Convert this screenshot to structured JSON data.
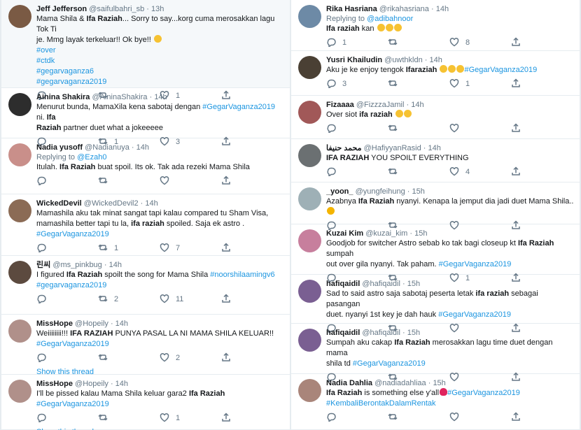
{
  "left": [
    {
      "name": "Jeff Jefferson",
      "handle": "@saifulbahri_sb",
      "time": "13h",
      "avatar_color": "#7a5a44",
      "lines": [
        [
          {
            "t": "Mama Shila & "
          },
          {
            "t": "Ifa Raziah",
            "b": true
          },
          {
            "t": "... Sorry to say...korg cuma merosakkan lagu Tok Ti"
          }
        ],
        [
          {
            "t": "je. Mmg layak terkeluar!! Ok bye!! "
          },
          {
            "e": "face"
          }
        ],
        [
          {
            "t": "#over",
            "tag": true
          }
        ],
        [
          {
            "t": "#ctdk",
            "tag": true
          }
        ],
        [
          {
            "t": "#gegarvaganza6",
            "tag": true
          }
        ],
        [
          {
            "t": "#gegarvaganza2019",
            "tag": true
          }
        ]
      ],
      "reply_count": "",
      "rt_count": "",
      "like_count": "1"
    },
    {
      "name": "Ainina Shakira",
      "handle": "@AininaShakira",
      "time": "14h",
      "avatar_color": "#2d2d2d",
      "lines": [
        [
          {
            "t": "Menurut bunda, MamaXila kena sabotaj dengan "
          },
          {
            "t": "#GegarVaganza2019",
            "tag": true
          },
          {
            "t": " ni. "
          },
          {
            "t": "Ifa",
            "b": true
          }
        ],
        [
          {
            "t": "Raziah",
            "b": true
          },
          {
            "t": " partner duet what a jokeeeee"
          }
        ]
      ],
      "reply_count": "",
      "rt_count": "1",
      "like_count": "3"
    },
    {
      "name": "Nadia yusoff",
      "handle": "@Nadianuya",
      "time": "14h",
      "avatar_color": "#c98f8a",
      "reply_to": "@Ezah0",
      "lines": [
        [
          {
            "t": "Itulah. "
          },
          {
            "t": "Ifa Raziah",
            "b": true
          },
          {
            "t": " buat spoil. Its ok. Tak ada rezeki Mama Shila"
          }
        ]
      ],
      "reply_count": "",
      "rt_count": "",
      "like_count": ""
    },
    {
      "name": "WickedDevil",
      "handle": "@WickedDevil2",
      "time": "14h",
      "avatar_color": "#8b6b55",
      "lines": [
        [
          {
            "t": "Mamashila aku tak minat sangat tapi kalau compared tu Sham Visa,"
          }
        ],
        [
          {
            "t": "mamashila better tapi tu la, "
          },
          {
            "t": "ifa raziah",
            "b": true
          },
          {
            "t": " spoiled. Saja ek astro ."
          }
        ],
        [
          {
            "t": "#GegarVaganza2019",
            "tag": true
          }
        ]
      ],
      "reply_count": "",
      "rt_count": "1",
      "like_count": "7"
    },
    {
      "name": "린씨",
      "handle": "@ms_pinkbug",
      "time": "14h",
      "avatar_color": "#5c4a3f",
      "lines": [
        [
          {
            "t": "I figured "
          },
          {
            "t": "Ifa Raziah",
            "b": true
          },
          {
            "t": " spoilt the song for Mama Shila "
          },
          {
            "t": "#noorshilaamingv6",
            "tag": true
          }
        ],
        [
          {
            "t": "#gegarvaganza2019",
            "tag": true
          }
        ]
      ],
      "reply_count": "",
      "rt_count": "2",
      "like_count": "11"
    },
    {
      "name": "MissHope",
      "handle": "@Hopeily",
      "time": "14h",
      "avatar_color": "#b0908a",
      "lines": [
        [
          {
            "t": "Weiiiiiiii!!! "
          },
          {
            "t": "IFA RAZIAH",
            "b": true
          },
          {
            "t": " PUNYA PASAL LA NI MAMA SHILA KELUAR!!"
          }
        ],
        [
          {
            "t": "#GegarVaganza2019",
            "tag": true
          }
        ]
      ],
      "reply_count": "",
      "rt_count": "",
      "like_count": "2",
      "show_thread": "Show this thread"
    },
    {
      "name": "MissHope",
      "handle": "@Hopeily",
      "time": "14h",
      "avatar_color": "#b0908a",
      "lines": [
        [
          {
            "t": "I'll be pissed kalau Mama Shila keluar gara2 "
          },
          {
            "t": "Ifa Raziah",
            "b": true
          },
          {
            "t": " "
          },
          {
            "t": "#GegarVaganza2019",
            "tag": true
          }
        ]
      ],
      "reply_count": "",
      "rt_count": "",
      "like_count": "1",
      "show_thread": "Show this thread"
    }
  ],
  "right": [
    {
      "name": "Rika Hasriana",
      "handle": "@rikahasriana",
      "time": "14h",
      "avatar_color": "#6d8aa6",
      "reply_to": "@adibahnoor",
      "lines": [
        [
          {
            "t": "Ifa raziah",
            "b": true
          },
          {
            "t": " kan "
          },
          {
            "e": "face"
          },
          {
            "e": "face"
          },
          {
            "e": "face"
          }
        ]
      ],
      "reply_count": "1",
      "rt_count": "",
      "like_count": "8"
    },
    {
      "name": "Yusri Khailudin",
      "handle": "@uwthkldn",
      "time": "14h",
      "avatar_color": "#4a4034",
      "lines": [
        [
          {
            "t": "Aku je ke enjoy tengok "
          },
          {
            "t": "Ifaraziah",
            "b": true
          },
          {
            "t": " "
          },
          {
            "e": "face"
          },
          {
            "e": "face"
          },
          {
            "e": "face"
          },
          {
            "t": "#GegarVaganza2019",
            "tag": true
          }
        ]
      ],
      "reply_count": "3",
      "rt_count": "",
      "like_count": "1"
    },
    {
      "name": "Fizaaaa",
      "handle": "@FizzzaJamil",
      "time": "14h",
      "avatar_color": "#a15858",
      "lines": [
        [
          {
            "t": "Over siot "
          },
          {
            "t": "ifa raziah",
            "b": true
          },
          {
            "t": " "
          },
          {
            "e": "face"
          },
          {
            "e": "face"
          }
        ]
      ],
      "reply_count": "",
      "rt_count": "",
      "like_count": ""
    },
    {
      "name": "محمد حنيفا",
      "handle": "@HafiyyanRasid",
      "time": "14h",
      "avatar_color": "#6b7072",
      "lines": [
        [
          {
            "t": "IFA RAZIAH",
            "b": true
          },
          {
            "t": " YOU SPOILT EVERYTHING"
          }
        ]
      ],
      "reply_count": "",
      "rt_count": "",
      "like_count": "4"
    },
    {
      "name": "_yoon_",
      "handle": "@yungfeihung",
      "time": "15h",
      "avatar_color": "#9eb0b6",
      "lines": [
        [
          {
            "t": "Azabnya "
          },
          {
            "t": "Ifa Raziah",
            "b": true
          },
          {
            "t": " nyanyi. Kenapa la jemput dia jadi duet Mama Shila.."
          },
          {
            "e": "thinking"
          }
        ]
      ],
      "reply_count": "",
      "rt_count": "",
      "like_count": ""
    },
    {
      "name": "Kuzai Kim",
      "handle": "@kuzai_kim",
      "time": "15h",
      "avatar_color": "#c77f9d",
      "lines": [
        [
          {
            "t": "Goodjob for switcher Astro sebab ko tak bagi closeup kt "
          },
          {
            "t": "Ifa Raziah",
            "b": true
          },
          {
            "t": " sumpah"
          }
        ],
        [
          {
            "t": "out over gila nyanyi. Tak paham. "
          },
          {
            "t": "#GegarVaganza2019",
            "tag": true
          }
        ]
      ],
      "reply_count": "",
      "rt_count": "",
      "like_count": "1"
    },
    {
      "name": "hafiqaidil",
      "handle": "@hafiqaidil",
      "time": "15h",
      "avatar_color": "#7a5f92",
      "lines": [
        [
          {
            "t": "Sad to said astro saja sabotaj peserta letak "
          },
          {
            "t": "ifa raziah",
            "b": true
          },
          {
            "t": " sebagai pasangan"
          }
        ],
        [
          {
            "t": "duet.  nyanyi 1st key je dah hauk "
          },
          {
            "t": "#GegarVaganza2019",
            "tag": true
          }
        ]
      ],
      "reply_count": "",
      "rt_count": "",
      "like_count": ""
    },
    {
      "name": "hafiqaidil",
      "handle": "@hafiqaidil",
      "time": "15h",
      "avatar_color": "#7a5f92",
      "lines": [
        [
          {
            "t": "Sumpah aku cakap "
          },
          {
            "t": "Ifa Raziah",
            "b": true
          },
          {
            "t": " merosakkan lagu time duet dengan mama"
          }
        ],
        [
          {
            "t": "shila td "
          },
          {
            "t": "#GegarVaganza2019",
            "tag": true
          }
        ]
      ],
      "reply_count": "",
      "rt_count": "",
      "like_count": ""
    },
    {
      "name": "Nadia Dahlia",
      "handle": "@nadiadahliaa",
      "time": "15h",
      "avatar_color": "#a9857a",
      "lines": [
        [
          {
            "t": "Ifa Raziah",
            "b": true
          },
          {
            "t": " is something else y'all"
          },
          {
            "e": "heart"
          },
          {
            "t": "#GegarVaganza2019",
            "tag": true
          }
        ],
        [
          {
            "t": "#KembaliBerontakDalamRentak",
            "tag": true
          }
        ]
      ],
      "reply_count": "",
      "rt_count": "",
      "like_count": ""
    }
  ]
}
